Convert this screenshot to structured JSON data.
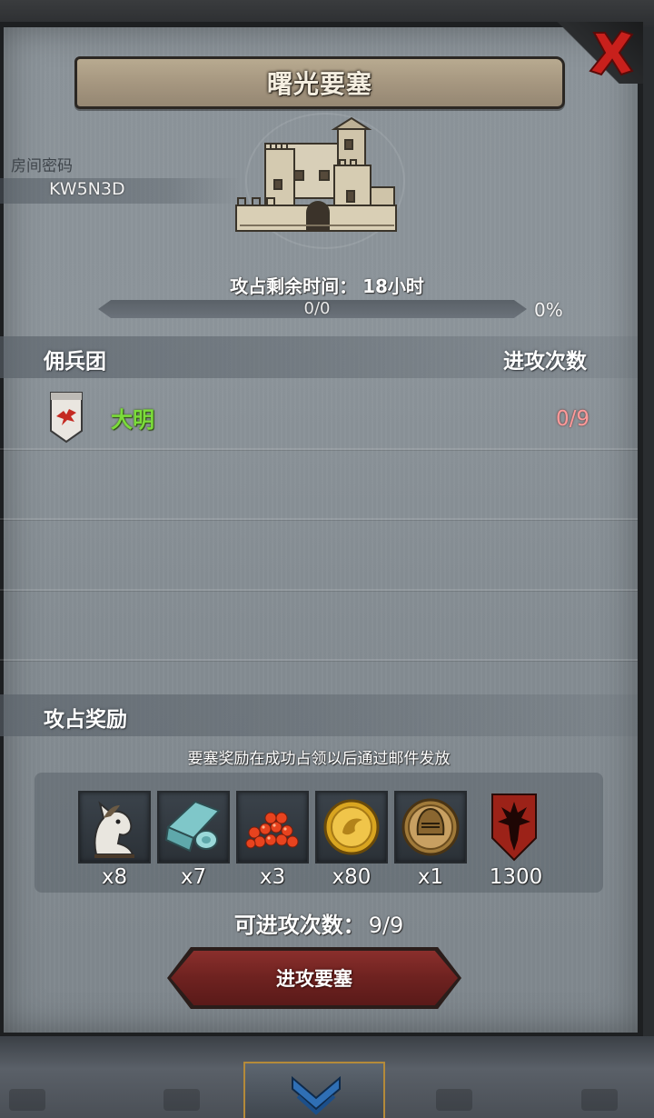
{
  "dialog": {
    "title": "曙光要塞",
    "close_icon": "close-x-icon"
  },
  "room": {
    "password_label": "房间密码",
    "password_value": "KW5N3D"
  },
  "siege": {
    "time_label": "攻占剩余时间：",
    "time_value": "18小时",
    "progress_text": "0/0",
    "progress_percent_text": "0%",
    "progress_fraction": 0
  },
  "mercenaries": {
    "header_left": "佣兵团",
    "header_right": "进攻次数",
    "rows": [
      {
        "icon": "red-bird-banner-icon",
        "name": "大明",
        "attempts": "0/9",
        "name_color": "#7bdc3a"
      }
    ]
  },
  "rewards": {
    "header": "攻占奖励",
    "note": "要塞奖励在成功占领以后通过邮件发放",
    "items": [
      {
        "icon": "horse-icon",
        "quantity": "x8"
      },
      {
        "icon": "cloth-roll-icon",
        "quantity": "x7"
      },
      {
        "icon": "red-beads-icon",
        "quantity": "x3"
      },
      {
        "icon": "gold-coin-icon",
        "quantity": "x80"
      },
      {
        "icon": "knight-helmet-medal-icon",
        "quantity": "x1"
      },
      {
        "icon": "red-shield-emblem-icon",
        "quantity": "1300"
      }
    ]
  },
  "attack": {
    "attempts_label": "可进攻次数：",
    "attempts_value": "9/9",
    "button_label": "进攻要塞"
  }
}
